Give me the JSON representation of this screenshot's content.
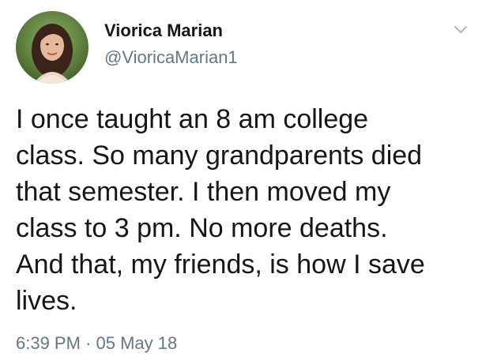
{
  "author": {
    "display_name": "Viorica Marian",
    "handle": "@VioricaMarian1",
    "avatar_icon": "profile-photo"
  },
  "tweet": {
    "text": "I once taught an 8 am college\nclass. So many grandparents died\nthat semester. I then moved my\nclass to 3 pm. No more deaths.\nAnd that, my friends, is how I save\nlives.",
    "time": "6:39 PM",
    "separator": "·",
    "date": "05 May 18"
  },
  "menu": {
    "icon": "chevron-down-icon"
  },
  "colors": {
    "text": "#14171a",
    "secondary": "#657786",
    "background": "#ffffff"
  }
}
